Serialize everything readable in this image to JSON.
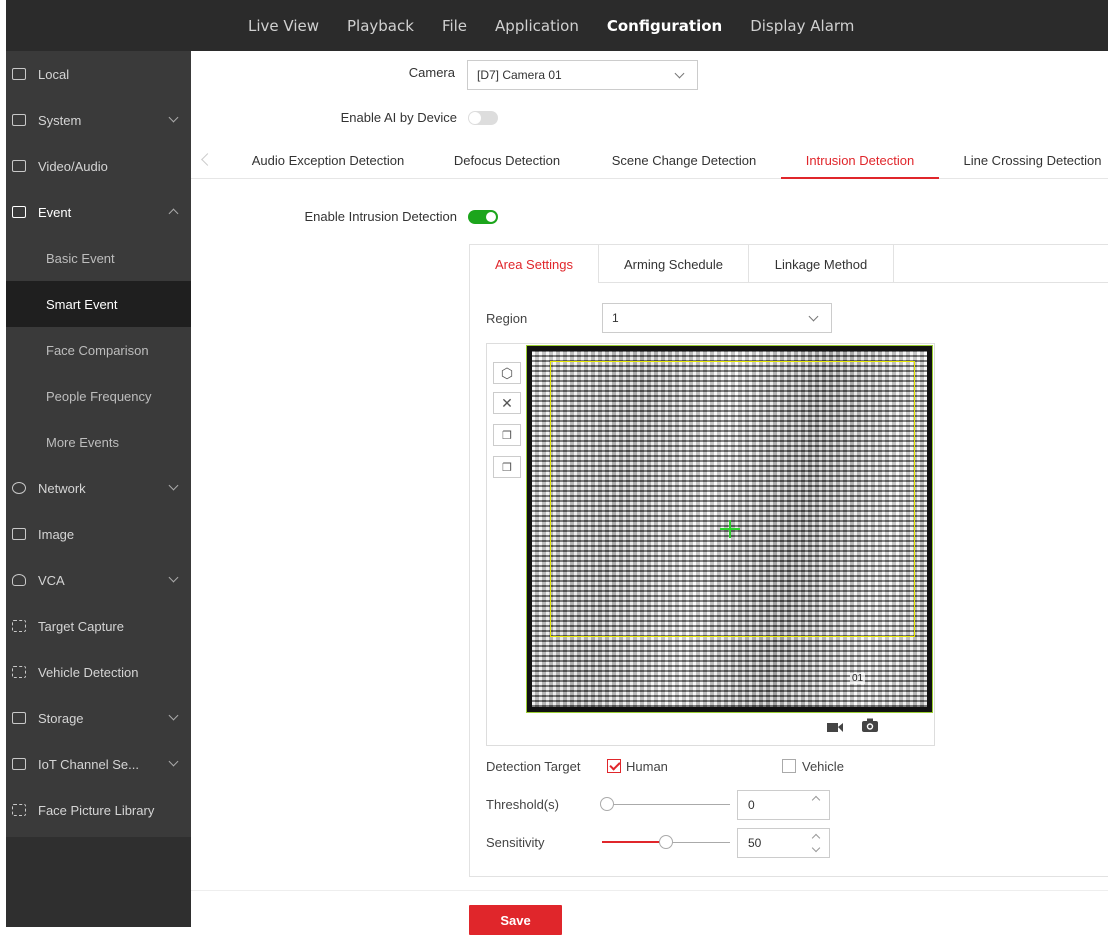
{
  "topnav": [
    "Live View",
    "Playback",
    "File",
    "Application",
    "Configuration",
    "Display Alarm"
  ],
  "topnav_active": "Configuration",
  "sidebar": {
    "items": [
      {
        "label": "Local",
        "icon": "monitor-icon"
      },
      {
        "label": "System",
        "icon": "display-icon"
      },
      {
        "label": "Video/Audio",
        "icon": "video-audio-icon"
      },
      {
        "label": "Event",
        "icon": "clipboard-icon"
      },
      {
        "label": "Basic Event"
      },
      {
        "label": "Smart Event"
      },
      {
        "label": "Face Comparison"
      },
      {
        "label": "People Frequency"
      },
      {
        "label": "More Events"
      },
      {
        "label": "Network",
        "icon": "globe-icon"
      },
      {
        "label": "Image",
        "icon": "image-icon"
      },
      {
        "label": "VCA",
        "icon": "bulb-icon"
      },
      {
        "label": "Target Capture",
        "icon": "target-capture-icon"
      },
      {
        "label": "Vehicle Detection",
        "icon": "car-icon"
      },
      {
        "label": "Storage",
        "icon": "save-icon"
      },
      {
        "label": "IoT Channel Se...",
        "icon": "iot-icon"
      },
      {
        "label": "Face Picture Library",
        "icon": "face-scan-icon"
      }
    ]
  },
  "form": {
    "camera_label": "Camera",
    "camera_value": "[D7] Camera 01",
    "enable_ai_label": "Enable AI by Device",
    "enable_ai_on": false,
    "enable_intrusion_label": "Enable Intrusion Detection",
    "enable_intrusion_on": true
  },
  "tabs": [
    "Audio Exception Detection",
    "Defocus Detection",
    "Scene Change Detection",
    "Intrusion Detection",
    "Line Crossing Detection"
  ],
  "active_tab": "Intrusion Detection",
  "subtabs": [
    "Area Settings",
    "Arming Schedule",
    "Linkage Method"
  ],
  "active_subtab": "Area Settings",
  "region": {
    "label": "Region",
    "value": "1"
  },
  "video_overlay_text": "01",
  "detection_target": {
    "label": "Detection Target",
    "human": "Human",
    "human_checked": true,
    "vehicle": "Vehicle",
    "vehicle_checked": false
  },
  "threshold": {
    "label": "Threshold(s)",
    "value": "0",
    "fraction": 0.0
  },
  "sensitivity": {
    "label": "Sensitivity",
    "value": "50",
    "fraction": 0.5
  },
  "save_label": "Save",
  "colors": {
    "accent": "#e0262b",
    "toggle_on": "#1ca51c",
    "sidebar": "#3a3a3a",
    "topbar": "#2b2b2b"
  }
}
